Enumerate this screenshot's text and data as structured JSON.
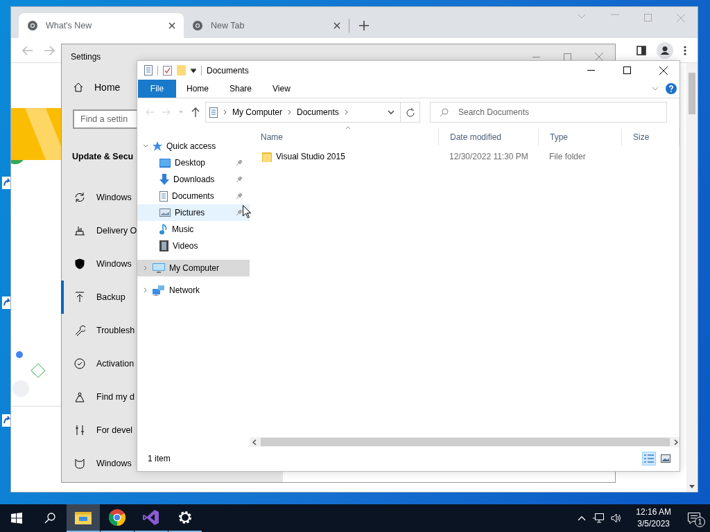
{
  "browser": {
    "tabs": [
      {
        "title": "What's New",
        "selected": true
      },
      {
        "title": "New Tab",
        "selected": false
      }
    ]
  },
  "settings": {
    "title": "Settings",
    "home": "Home",
    "search": {
      "placeholder": "Find a settin"
    },
    "section": "Update & Secu",
    "nav": [
      {
        "kind": "update",
        "label": "Windows",
        "selected": false
      },
      {
        "kind": "delivery",
        "label": "Delivery O",
        "selected": false
      },
      {
        "kind": "shield",
        "label": "Windows",
        "selected": false
      },
      {
        "kind": "backup",
        "label": "Backup",
        "selected": true
      },
      {
        "kind": "wrench",
        "label": "Troublesh",
        "selected": false
      },
      {
        "kind": "check",
        "label": "Activation",
        "selected": false
      },
      {
        "kind": "find",
        "label": "Find my d",
        "selected": false
      },
      {
        "kind": "developer",
        "label": "For devel",
        "selected": false
      },
      {
        "kind": "insider",
        "label": "Windows",
        "selected": false
      }
    ]
  },
  "explorer": {
    "title": "Documents",
    "ribbon_tabs": [
      {
        "label": "File",
        "kind": "file"
      },
      {
        "label": "Home",
        "kind": "tab"
      },
      {
        "label": "Share",
        "kind": "tab"
      },
      {
        "label": "View",
        "kind": "tab"
      }
    ],
    "breadcrumb": [
      "My Computer",
      "Documents"
    ],
    "search": {
      "placeholder": "Search Documents"
    },
    "columns": [
      "Name",
      "Date modified",
      "Type",
      "Size"
    ],
    "tree": [
      {
        "label": "Quick access",
        "kind": "star",
        "expanded": true,
        "selected": false,
        "children": [
          {
            "label": "Desktop",
            "kind": "desktop",
            "pinned": true,
            "highlighted": false
          },
          {
            "label": "Downloads",
            "kind": "download",
            "pinned": true,
            "highlighted": false
          },
          {
            "label": "Documents",
            "kind": "document",
            "pinned": true,
            "highlighted": false
          },
          {
            "label": "Pictures",
            "kind": "picture",
            "pinned": true,
            "highlighted": true
          },
          {
            "label": "Music",
            "kind": "music",
            "pinned": false,
            "highlighted": false
          },
          {
            "label": "Videos",
            "kind": "video",
            "pinned": false,
            "highlighted": false
          }
        ]
      },
      {
        "label": "My Computer",
        "kind": "computer",
        "expanded": false,
        "selected": true
      },
      {
        "label": "Network",
        "kind": "network",
        "expanded": false,
        "selected": false
      }
    ],
    "files": [
      {
        "name": "Visual Studio 2015",
        "date": "12/30/2022 11:30 PM",
        "type": "File folder"
      }
    ],
    "status": "1 item",
    "views": [
      {
        "kind": "details",
        "selected": true
      },
      {
        "kind": "large",
        "selected": false
      }
    ]
  },
  "taskbar": {
    "apps": [
      {
        "kind": "explorer",
        "selected": true
      },
      {
        "kind": "chrome",
        "selected": false
      },
      {
        "kind": "studio",
        "selected": false
      },
      {
        "kind": "settings",
        "selected": false
      }
    ],
    "time": "12:16 AM",
    "date": "3/5/2023",
    "notifications": "1"
  }
}
